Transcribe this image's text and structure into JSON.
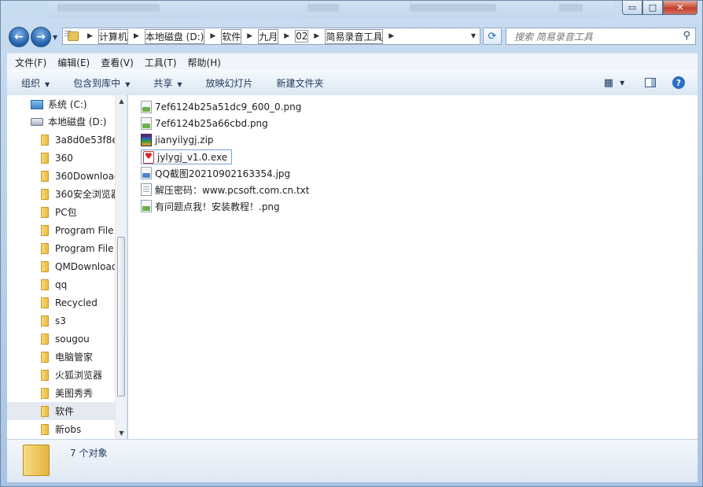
{
  "window": {
    "caption_buttons": [
      "▭",
      "□",
      "✕"
    ]
  },
  "nav": {
    "back_icon": "←",
    "forward_icon": "→",
    "breadcrumb": [
      "计算机",
      "本地磁盘 (D:)",
      "软件",
      "九月",
      "02",
      "简易录音工具"
    ],
    "refresh_icon": "⟳",
    "search_placeholder": "搜索 简易录音工具"
  },
  "menu": {
    "file": "文件(F)",
    "edit": "编辑(E)",
    "view": "查看(V)",
    "tools": "工具(T)",
    "help": "帮助(H)"
  },
  "toolbar": {
    "organize": "组织",
    "include_in_library": "包含到库中",
    "share": "共享",
    "slideshow": "放映幻灯片",
    "new_folder": "新建文件夹",
    "dropdown_arrow": "▼",
    "help_icon": "?"
  },
  "tree": {
    "drives": [
      {
        "label": "系统 (C:)"
      },
      {
        "label": "本地磁盘 (D:)"
      }
    ],
    "folders": [
      {
        "label": "3a8d0e53f8e"
      },
      {
        "label": "360"
      },
      {
        "label": "360Download"
      },
      {
        "label": "360安全浏览器"
      },
      {
        "label": "PC包"
      },
      {
        "label": "Program File"
      },
      {
        "label": "Program File"
      },
      {
        "label": "QMDownload"
      },
      {
        "label": "qq"
      },
      {
        "label": "Recycled"
      },
      {
        "label": "s3"
      },
      {
        "label": "sougou"
      },
      {
        "label": "电脑管家"
      },
      {
        "label": "火狐浏览器"
      },
      {
        "label": "美图秀秀"
      },
      {
        "label": "软件"
      },
      {
        "label": "新obs"
      }
    ]
  },
  "files": [
    {
      "name": "7ef6124b25a51dc9_600_0.png",
      "type": "png"
    },
    {
      "name": "7ef6124b25a66cbd.png",
      "type": "png"
    },
    {
      "name": "jianyilygj.zip",
      "type": "zip"
    },
    {
      "name": "jylygj_v1.0.exe",
      "type": "exe"
    },
    {
      "name": "QQ截图20210902163354.jpg",
      "type": "jpg"
    },
    {
      "name": "解压密码：www.pcsoft.com.cn.txt",
      "type": "txt"
    },
    {
      "name": "有问题点我！安装教程！.png",
      "type": "png"
    }
  ],
  "status": {
    "count": "7 个对象"
  }
}
